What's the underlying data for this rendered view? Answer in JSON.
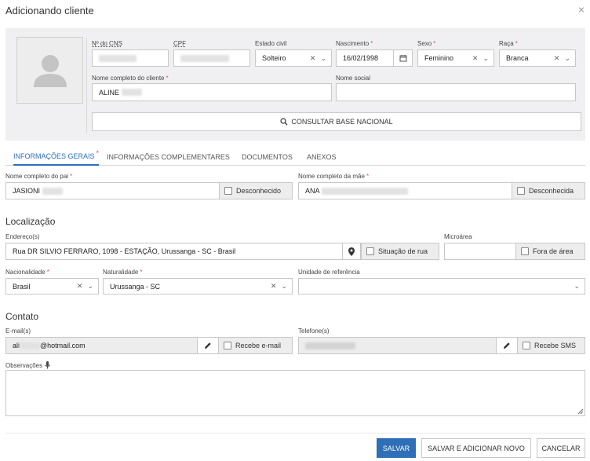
{
  "dialog": {
    "title": "Adicionando cliente",
    "close_icon": "×"
  },
  "identity": {
    "cns": {
      "label": "Nº do CNS",
      "value": ""
    },
    "cpf": {
      "label": "CPF",
      "value": ""
    },
    "estado_civil": {
      "label": "Estado civil",
      "value": "Solteiro"
    },
    "nascimento": {
      "label": "Nascimento",
      "value": "16/02/1998"
    },
    "sexo": {
      "label": "Sexo",
      "value": "Feminino"
    },
    "raca": {
      "label": "Raça",
      "value": "Branca"
    },
    "nome_completo": {
      "label": "Nome completo do cliente",
      "value": "ALINE"
    },
    "nome_social": {
      "label": "Nome social",
      "value": ""
    },
    "consultar_label": "CONSULTAR BASE NACIONAL"
  },
  "tabs": [
    {
      "label": "INFORMAÇÕES GERAIS",
      "active": true
    },
    {
      "label": "INFORMAÇÕES COMPLEMENTARES"
    },
    {
      "label": "DOCUMENTOS"
    },
    {
      "label": "ANEXOS"
    }
  ],
  "parents": {
    "pai": {
      "label": "Nome completo do pai",
      "value": "JASIONI",
      "unknown_label": "Desconhecido"
    },
    "mae": {
      "label": "Nome completo da mãe",
      "value": "ANA",
      "unknown_label": "Desconhecida"
    }
  },
  "localizacao": {
    "title": "Localização",
    "endereco": {
      "label": "Endereço(s)",
      "value": "Rua DR SILVIO FERRARO, 1098 - ESTAÇÃO, Urussanga - SC - Brasil"
    },
    "situacao_rua_label": "Situação de rua",
    "microarea": {
      "label": "Microárea",
      "value": ""
    },
    "fora_area_label": "Fora de área",
    "nacionalidade": {
      "label": "Nacionalidade",
      "value": "Brasil"
    },
    "naturalidade": {
      "label": "Naturalidade",
      "value": "Urussanga - SC"
    },
    "unidade": {
      "label": "Unidade de referência",
      "value": ""
    }
  },
  "contato": {
    "title": "Contato",
    "email": {
      "label": "E-mail(s)",
      "value_prefix": "ali",
      "value_suffix": "@hotmail.com",
      "check_label": "Recebe e-mail"
    },
    "telefone": {
      "label": "Telefone(s)",
      "value": "",
      "check_label": "Recebe SMS"
    },
    "observacoes": {
      "label": "Observações"
    }
  },
  "footer": {
    "salvar": "SALVAR",
    "salvar_novo": "SALVAR E ADICIONAR NOVO",
    "cancelar": "CANCELAR"
  },
  "colors": {
    "primary": "#2e6fb7",
    "required": "#d9534f",
    "panel_bg": "#f0f0f3"
  }
}
